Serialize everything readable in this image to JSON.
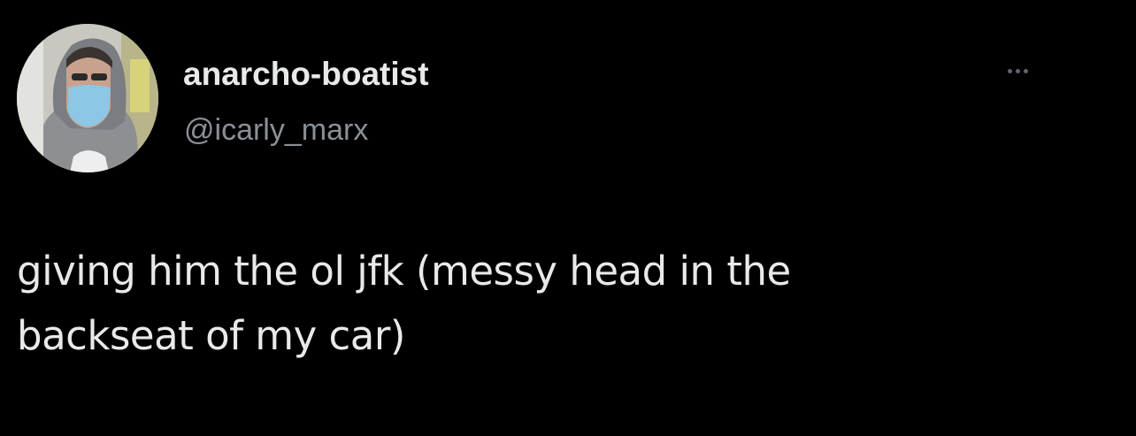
{
  "tweet": {
    "author": {
      "display_name": "anarcho-boatist",
      "handle": "@icarly_marx",
      "avatar_icon": "user-avatar-photo"
    },
    "more_icon": "more-options-icon",
    "text_lines": [
      "giving him the ol jfk (messy head in the",
      "backseat of my car)"
    ]
  },
  "colors": {
    "background": "#000000",
    "primary_text": "#e7e9ea",
    "secondary_text": "#8b9096"
  }
}
